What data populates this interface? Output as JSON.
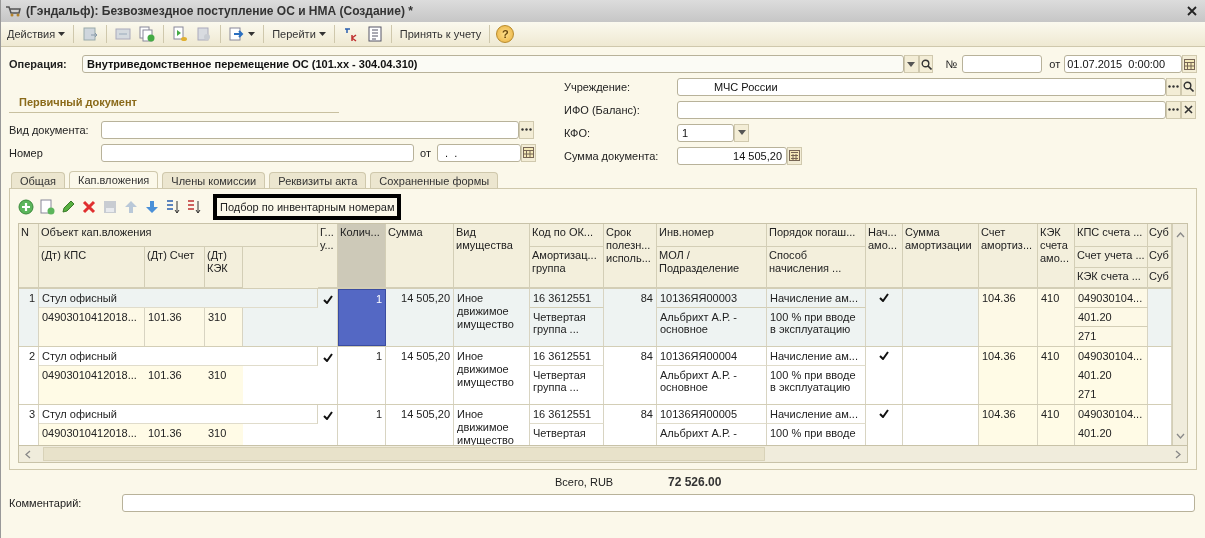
{
  "window": {
    "title": "(Гэндальф): Безвозмездное поступление ОС и НМА (Создание) *"
  },
  "toolbar": {
    "actions": "Действия",
    "goto": "Перейти",
    "accept": "Принять к учету",
    "help": "?"
  },
  "operation": {
    "label": "Операция:",
    "value": "Внутриведомственное перемещение ОС (101.xx - 304.04.310)",
    "number_label": "№",
    "date_label": "от",
    "date": "01.07.2015  0:00:00"
  },
  "primary_document": {
    "title": "Первичный документ",
    "doc_type_label": "Вид документа:",
    "number_label": "Номер",
    "date_label": "от",
    "date": " .  ."
  },
  "details": {
    "institution_label": "Учреждение:",
    "institution": "МЧС России",
    "ifo_label": "ИФО (Баланс):",
    "kfo_label": "КФО:",
    "kfo": "1",
    "sum_label": "Сумма документа:",
    "sum": "14 505,20"
  },
  "tabs": [
    {
      "label": "Общая",
      "selected": false
    },
    {
      "label": "Кап.вложения",
      "selected": true
    },
    {
      "label": "Члены комиссии",
      "selected": false
    },
    {
      "label": "Реквизиты акта",
      "selected": false
    },
    {
      "label": "Сохраненные формы",
      "selected": false
    }
  ],
  "table": {
    "pick_button": "Подбор по инвентарным номерам",
    "headers": [
      {
        "label": "N",
        "selected": false
      },
      {
        "label": "Объект кап.вложения",
        "selected": false
      },
      {
        "label": "(Дт) КПС",
        "selected": false
      },
      {
        "label": "(Дт) Счет",
        "selected": false
      },
      {
        "label": "(Дт) КЭК",
        "selected": false
      },
      {
        "label": "Г... у...",
        "selected": false
      },
      {
        "label": "Колич...",
        "selected": true
      },
      {
        "label": "Сумма",
        "selected": false
      },
      {
        "label": "Вид имущества",
        "selected": false
      },
      {
        "label": "Код по ОК...",
        "selected": false
      },
      {
        "label": "Амортизац... группа",
        "selected": false
      },
      {
        "label": "Срок полезн... исполь...",
        "selected": false
      },
      {
        "label": "Инв.номер",
        "selected": false
      },
      {
        "label": "МОЛ / Подразделение",
        "selected": false
      },
      {
        "label": "Порядок погаш...",
        "selected": false
      },
      {
        "label": "Способ начисления ...",
        "selected": false
      },
      {
        "label": "Нач... амо...",
        "selected": false
      },
      {
        "label": "Сумма амортизации",
        "selected": false
      },
      {
        "label": "Счет амортиз...",
        "selected": false
      },
      {
        "label": "КЭК счета амо...",
        "selected": false
      },
      {
        "label": "КПС счета ...",
        "selected": false
      },
      {
        "label": "Счет учета ...",
        "selected": false
      },
      {
        "label": "КЭК счета ...",
        "selected": false
      },
      {
        "label": "Суб",
        "selected": false
      },
      {
        "label": "Суб",
        "selected": false
      },
      {
        "label": "Суб",
        "selected": false
      }
    ],
    "rows": [
      {
        "selected": true,
        "n": "1",
        "name": "Стул офисный",
        "kps": "04903010412018...",
        "account": "101.36",
        "kek": "310",
        "in_use": true,
        "quantity": "1",
        "sum": "14 505,20",
        "property_kind": "Иное движимое имущество",
        "okof": "16 3612551",
        "amort_group": "Четвертая группа ...",
        "life": "84",
        "inv": "10136ЯЯ00003",
        "mol": "Альбрихт А.Р. - основное",
        "order": "Начисление ам...",
        "method": "100 % при вводе в эксплуатацию",
        "amortize": true,
        "amort_account": "104.36",
        "amort_kek": "410",
        "kps_account": "049030104...",
        "account2": "401.20",
        "kek2": "271"
      },
      {
        "selected": false,
        "n": "2",
        "name": "Стул офисный",
        "kps": "04903010412018...",
        "account": "101.36",
        "kek": "310",
        "in_use": true,
        "quantity": "1",
        "sum": "14 505,20",
        "property_kind": "Иное движимое имущество",
        "okof": "16 3612551",
        "amort_group": "Четвертая группа ...",
        "life": "84",
        "inv": "10136ЯЯ00004",
        "mol": "Альбрихт А.Р. - основное",
        "order": "Начисление ам...",
        "method": "100 % при вводе в эксплуатацию",
        "amortize": true,
        "amort_account": "104.36",
        "amort_kek": "410",
        "kps_account": "049030104...",
        "account2": "401.20",
        "kek2": "271"
      },
      {
        "selected": false,
        "n": "3",
        "name": "Стул офисный",
        "kps": "04903010412018...",
        "account": "101.36",
        "kek": "310",
        "in_use": true,
        "quantity": "1",
        "sum": "14 505,20",
        "property_kind": "Иное движимое имущество",
        "okof": "16 3612551",
        "amort_group": "Четвертая",
        "life": "84",
        "inv": "10136ЯЯ00005",
        "mol": "Альбрихт А.Р. -",
        "order": "Начисление ам...",
        "method": "100 % при вводе",
        "amortize": true,
        "amort_account": "104.36",
        "amort_kek": "410",
        "kps_account": "049030104...",
        "account2": "401.20"
      }
    ]
  },
  "total": {
    "label": "Всего, RUB",
    "value": "72 526.00"
  },
  "comment": {
    "label": "Комментарий:"
  }
}
